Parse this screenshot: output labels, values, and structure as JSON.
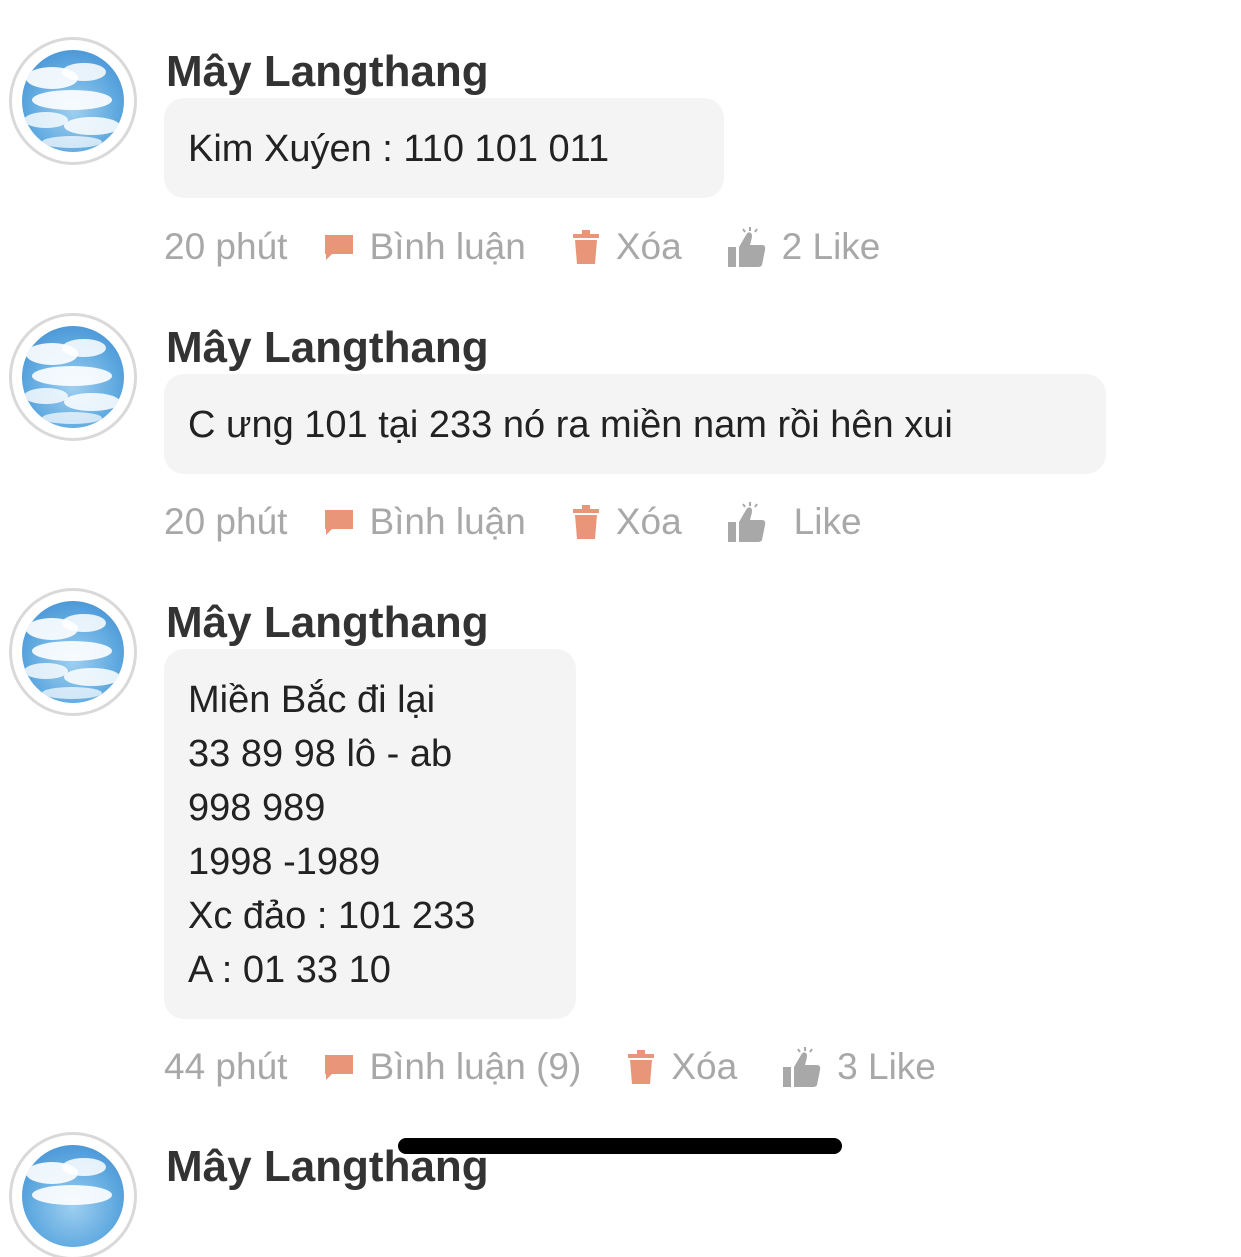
{
  "colors": {
    "accent": "#e9957a",
    "muted": "#a8a8a8",
    "bubble": "#f4f4f4",
    "author": "#333333"
  },
  "posts": [
    {
      "author": "Mây Langthang",
      "lines": [
        "Kim Xuýen : 110 101 011"
      ],
      "time": "20 phút",
      "comment_label": "Bình luận",
      "delete_label": "Xóa",
      "like_label": "2 Like"
    },
    {
      "author": "Mây Langthang",
      "lines": [
        "C ưng 101 tại 233 nó ra miền nam rồi hên xui"
      ],
      "time": "20 phút",
      "comment_label": "Bình luận",
      "delete_label": "Xóa",
      "like_label": "Like"
    },
    {
      "author": "Mây Langthang",
      "lines": [
        "Miền Bắc đi lại",
        "33 89 98 lô - ab",
        "998 989",
        "1998 -1989",
        "Xc đảo : 101 233",
        "A : 01 33 10"
      ],
      "time": "44 phút",
      "comment_label": "Bình luận (9)",
      "delete_label": "Xóa",
      "like_label": "3 Like"
    },
    {
      "author": "Mây Langthang"
    }
  ],
  "icons": {
    "avatar": "sky-clouds-avatar",
    "comment": "comment-icon",
    "delete": "trash-icon",
    "like": "thumbs-up-icon"
  }
}
